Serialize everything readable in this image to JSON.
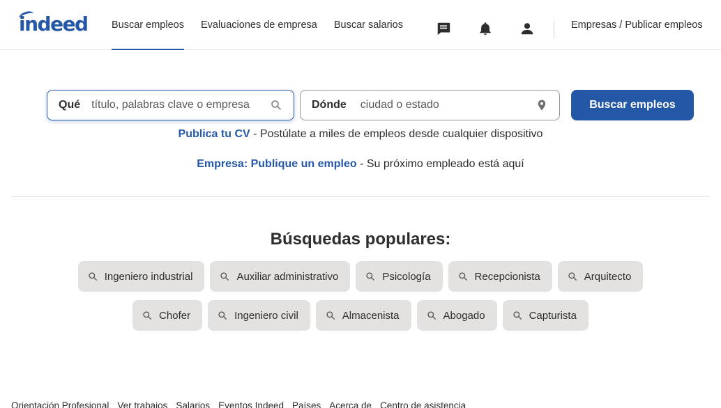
{
  "brand": {
    "logo_text": "indeed",
    "accent": "#2557a7"
  },
  "nav": {
    "items": [
      {
        "label": "Buscar empleos",
        "active": true
      },
      {
        "label": "Evaluaciones de empresa",
        "active": false
      },
      {
        "label": "Buscar salarios",
        "active": false
      }
    ],
    "icons": [
      "message-icon",
      "bell-icon",
      "user-icon"
    ],
    "employers_label": "Empresas / Publicar empleos"
  },
  "search": {
    "what_label": "Qué",
    "what_placeholder": "título, palabras clave o empresa",
    "where_label": "Dónde",
    "where_placeholder": "ciudad o estado",
    "button_label": "Buscar empleos"
  },
  "promos": [
    {
      "link": "Publica tu CV",
      "text": " - Postúlate a miles de empleos desde cualquier dispositivo"
    },
    {
      "link": "Empresa: Publique un empleo",
      "text": " - Su próximo empleado está aquí"
    }
  ],
  "popular": {
    "title": "Búsquedas populares:",
    "rows": [
      [
        "Ingeniero industrial",
        "Auxiliar administrativo",
        "Psicología",
        "Recepcionista",
        "Arquitecto"
      ],
      [
        "Chofer",
        "Ingeniero civil",
        "Almacenista",
        "Abogado",
        "Capturista"
      ]
    ]
  },
  "footer": {
    "links": [
      "Orientación Profesional",
      "Ver trabajos",
      "Salarios",
      "Eventos Indeed",
      "Países",
      "Acerca de",
      "Centro de asistencia"
    ]
  }
}
